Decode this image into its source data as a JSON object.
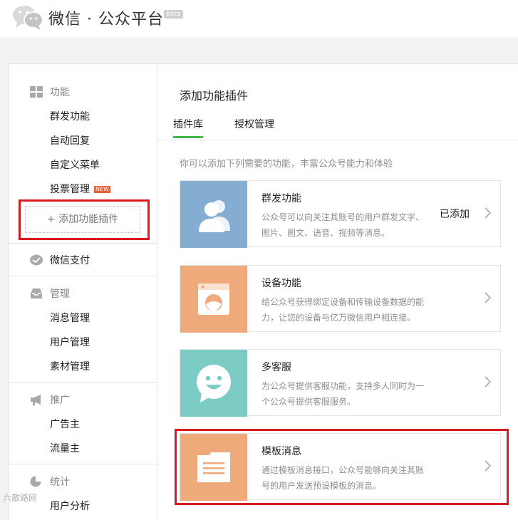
{
  "header": {
    "brand": "微信 · 公众平台",
    "beta": "Beta",
    "logo_icon": "wechat-logo-icon"
  },
  "sidebar": {
    "sections": [
      {
        "title": "功能",
        "icon": "grid-icon",
        "items": [
          "群发功能",
          "自动回复",
          "自定义菜单",
          "投票管理"
        ],
        "new_badge": "NEW"
      },
      {
        "title": "微信支付",
        "icon": "wechat-pay-icon",
        "items": []
      },
      {
        "title": "管理",
        "icon": "inbox-icon",
        "items": [
          "消息管理",
          "用户管理",
          "素材管理"
        ]
      },
      {
        "title": "推广",
        "icon": "megaphone-icon",
        "items": [
          "广告主",
          "流量主"
        ]
      },
      {
        "title": "统计",
        "icon": "pie-chart-icon",
        "items": [
          "用户分析"
        ]
      }
    ],
    "add_plugin": "+ 添加功能插件"
  },
  "main": {
    "title": "添加功能插件",
    "tabs": [
      "插件库",
      "授权管理"
    ],
    "description": "你可以添加下列需要的功能，丰富公众号能力和体验",
    "plugins": [
      {
        "title": "群发功能",
        "desc": "公众号可以向关注其账号的用户群发文字、图片、图文、语音、视频等消息。",
        "status": "已添加",
        "color": "#85add1",
        "icon": "users-icon"
      },
      {
        "title": "设备功能",
        "desc": "给公众号获得绑定设备和传输设备数据的能力，让您的设备与亿万微信用户相连接。",
        "status": "",
        "color": "#eeaa7b",
        "icon": "device-icon"
      },
      {
        "title": "多客服",
        "desc": "为公众号提供客服功能，支持多人同时为一个公众号提供客服服务。",
        "status": "",
        "color": "#7ccbc4",
        "icon": "smiley-chat-icon"
      },
      {
        "title": "模板消息",
        "desc": "通过模板消息接口，公众号能够向关注其账号的用户发送预设模板的消息。",
        "status": "",
        "color": "#eeaa7b",
        "icon": "document-icon"
      }
    ]
  },
  "watermark": "六散路网",
  "colors": {
    "accent_green": "#44b549",
    "highlight_red": "#d8191f"
  }
}
